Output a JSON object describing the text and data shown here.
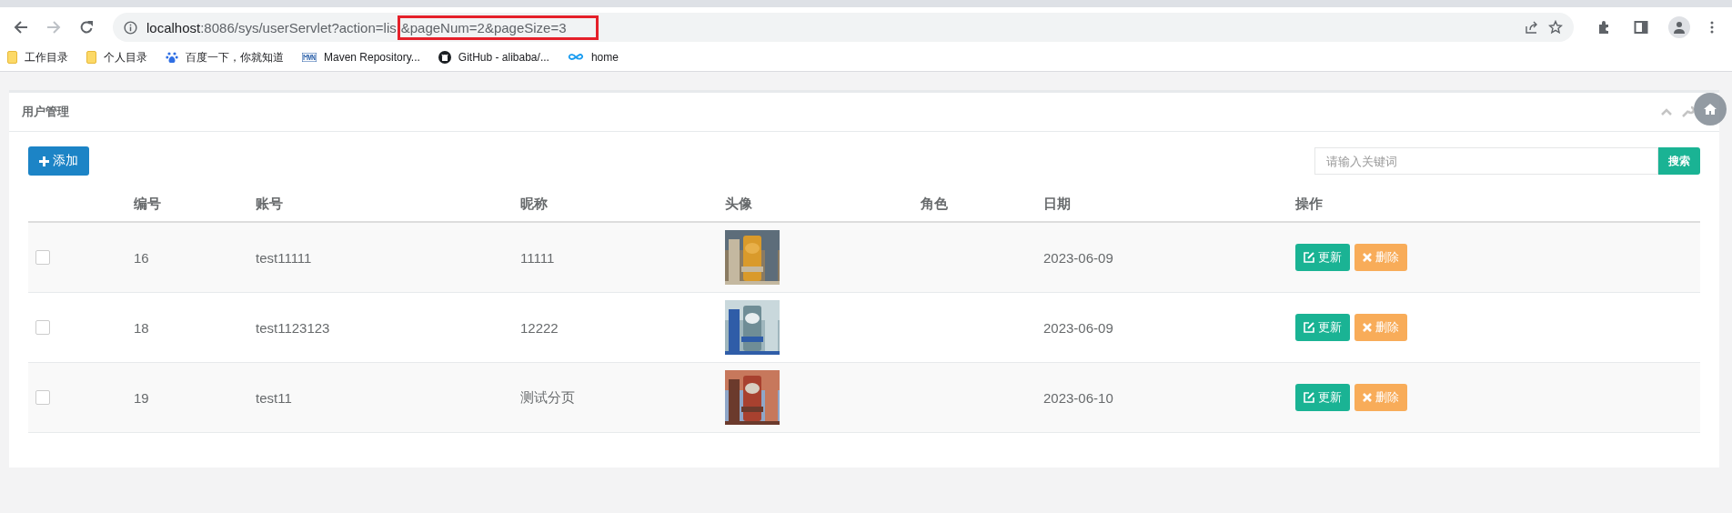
{
  "browser": {
    "url_host": "localhost",
    "url_path": ":8086/sys/userServlet?action=lis",
    "url_highlighted": "&pageNum=2&pageSize=3",
    "bookmarks": [
      {
        "label": "工作目录",
        "kind": "folder"
      },
      {
        "label": "个人目录",
        "kind": "folder"
      },
      {
        "label": "百度一下，你就知道",
        "kind": "paw"
      },
      {
        "label": "Maven Repository...",
        "kind": "mvn"
      },
      {
        "label": "GitHub - alibaba/...",
        "kind": "github"
      },
      {
        "label": "home",
        "kind": "infinity"
      }
    ]
  },
  "panel": {
    "title": "用户管理",
    "add_button": "添加",
    "search": {
      "placeholder": "请输入关键词",
      "button": "搜索"
    }
  },
  "table": {
    "columns": [
      "编号",
      "账号",
      "昵称",
      "头像",
      "角色",
      "日期",
      "操作"
    ],
    "rows": [
      {
        "checked": false,
        "id": "16",
        "account": "test11111",
        "nickname": "11111",
        "date": "2023-06-09",
        "update": "更新",
        "delete": "删除"
      },
      {
        "checked": false,
        "id": "18",
        "account": "test1123123",
        "nickname": "12222",
        "date": "2023-06-09",
        "update": "更新",
        "delete": "删除"
      },
      {
        "checked": false,
        "id": "19",
        "account": "test11",
        "nickname": "测试分页",
        "date": "2023-06-10",
        "update": "更新",
        "delete": "删除"
      }
    ]
  }
}
